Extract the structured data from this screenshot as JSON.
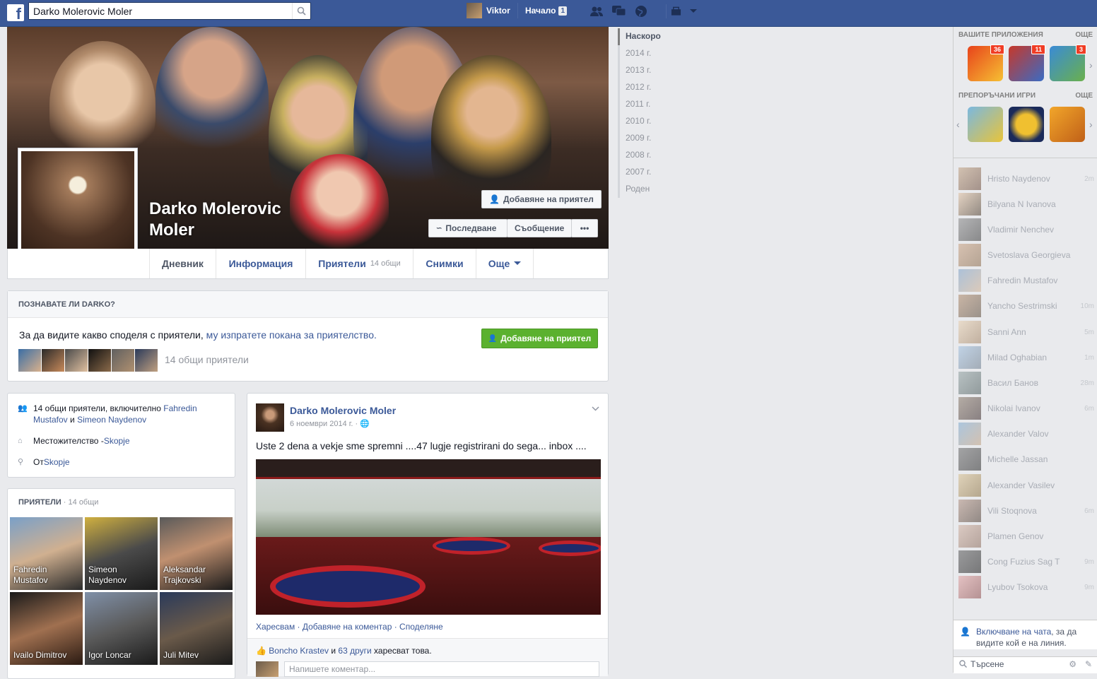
{
  "topbar": {
    "logo": "f",
    "search_value": "Darko Molerovic Moler",
    "user_name": "Viktor",
    "home_label": "Начало",
    "home_count": "1"
  },
  "profile": {
    "name": "Darko Molerovic Moler",
    "add_friend_label": "Добавяне на приятел",
    "follow_label": "Последване",
    "message_label": "Съобщение",
    "more_label": "•••"
  },
  "tabs": {
    "timeline": "Дневник",
    "about": "Информация",
    "friends": "Приятели",
    "friends_sub": "14 общи",
    "photos": "Снимки",
    "more": "Още"
  },
  "timeline_nav": [
    "Наскоро",
    "2014 г.",
    "2013 г.",
    "2012 г.",
    "2011 г.",
    "2010 г.",
    "2009 г.",
    "2008 г.",
    "2007 г.",
    "Роден"
  ],
  "know": {
    "header": "ПОЗНАВАТЕ ЛИ DARKO?",
    "text_plain": "За да видите какво споделя с приятели, ",
    "text_link": "му изпратете покана за приятелство.",
    "add_label": "Добавяне на приятел",
    "mutual": "14 общи приятели"
  },
  "about": {
    "mutual_prefix": "14 общи приятели, включително ",
    "mutual_name1": "Fahredin Mustafov",
    "mutual_and": " и ",
    "mutual_name2": "Simeon Naydenov",
    "lives_prefix": "Местожителство - ",
    "lives_city": "Skopje",
    "from_prefix": "От ",
    "from_city": "Skopje"
  },
  "friends_box": {
    "header": "ПРИЯТЕЛИ",
    "count": " · 14 общи",
    "items": [
      {
        "name": "Fahredin Mustafov"
      },
      {
        "name": "Simeon Naydenov"
      },
      {
        "name": "Aleksandar Trajkovski"
      },
      {
        "name": "Ivailo Dimitrov"
      },
      {
        "name": "Igor Loncar"
      },
      {
        "name": "Juli Mitev"
      }
    ]
  },
  "post": {
    "author": "Darko Molerovic Moler",
    "date": "6 ноември 2014 г. · ",
    "text": "Uste 2 dena a vekje sme spremni ....47 lugje registrirani do sega... inbox ....",
    "actions": "Харесвам · Добавяне на коментар · Споделяне",
    "likes_name": "Boncho Krastev",
    "likes_and": " и ",
    "likes_others": "63 други",
    "likes_suffix": " харесват това.",
    "comment_placeholder": "Напишете коментар..."
  },
  "rightcol": {
    "apps_header": "ВАШИТЕ ПРИЛОЖЕНИЯ",
    "apps_more": "ОЩЕ",
    "apps": [
      {
        "badge": "36",
        "colors": [
          "#e8431b",
          "#f6c033"
        ]
      },
      {
        "badge": "11",
        "colors": [
          "#c7382a",
          "#3a6bc4"
        ]
      },
      {
        "badge": "3",
        "colors": [
          "#3a8bd6",
          "#6ab04c"
        ]
      }
    ],
    "games_header": "ПРЕПОРЪЧАНИ ИГРИ",
    "games_more": "ОЩЕ",
    "chat": [
      {
        "name": "Hristo Naydenov",
        "time": "2m"
      },
      {
        "name": "Bilyana N Ivanova",
        "time": ""
      },
      {
        "name": "Vladimir Nenchev",
        "time": ""
      },
      {
        "name": "Svetoslava Georgieva",
        "time": ""
      },
      {
        "name": "Fahredin Mustafov",
        "time": ""
      },
      {
        "name": "Yancho Sestrimski",
        "time": "10m"
      },
      {
        "name": "Sanni Ann",
        "time": "5m"
      },
      {
        "name": "Milad Oghabian",
        "time": "1m"
      },
      {
        "name": "Васил Банов",
        "time": "28m"
      },
      {
        "name": "Nikolai Ivanov",
        "time": "6m"
      },
      {
        "name": "Alexander Valov",
        "time": ""
      },
      {
        "name": "Michelle Jassan",
        "time": ""
      },
      {
        "name": "Alexander Vasilev",
        "time": ""
      },
      {
        "name": "Vili Stoqnova",
        "time": "6m"
      },
      {
        "name": "Plamen Genov",
        "time": ""
      },
      {
        "name": "Cong Fuzius Sag T",
        "time": "9m"
      },
      {
        "name": "Lyubov Tsokova",
        "time": "9m"
      }
    ],
    "chat_on_link": "Включване на чата",
    "chat_on_rest": ", за да видите кой е на линия.",
    "chat_search": "Търсене"
  }
}
